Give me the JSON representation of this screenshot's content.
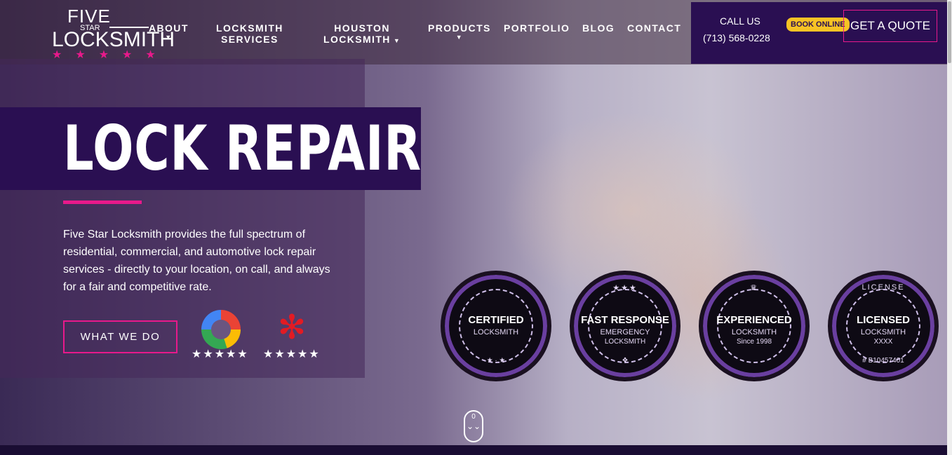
{
  "brand": {
    "logo_five": "FIVE",
    "logo_star": "STAR",
    "logo_locksmith": "LOCKSMITH",
    "logo_stars": "★★★★★",
    "accent_pink": "#e8198b",
    "accent_purple": "#2a0f52",
    "accent_yellow": "#f7c324"
  },
  "nav": {
    "about": "ABOUT",
    "locksmith_services_1": "LOCKSMITH",
    "locksmith_services_2": "SERVICES",
    "houston_locksmith_1": "HOUSTON",
    "houston_locksmith_2": "LOCKSMITH",
    "products": "PRODUCTS",
    "portfolio": "PORTFOLIO",
    "blog": "BLOG",
    "contact": "CONTACT",
    "caret": "▼"
  },
  "cta": {
    "call_label": "CALL US",
    "phone": "(713) 568-0228",
    "book_online": "BOOK ONLINE",
    "get_quote": "GET A QUOTE"
  },
  "hero": {
    "title": "LOCK REPAIR",
    "description": "Five Star Locksmith provides the full spectrum of residential, commercial, and automotive lock repair services - directly to your location, on call, and always for a fair and competitive rate.",
    "button": "WHAT WE DO",
    "google_stars": "★★★★★",
    "yelp_stars": "★★★★★",
    "yelp_glyph": "✻"
  },
  "badges": [
    {
      "top": "",
      "line1": "CERTIFIED",
      "line2": "LOCKSMITH",
      "line3": "",
      "bottom": "★ · ★"
    },
    {
      "top": "★★★",
      "line1": "FAST RESPONSE",
      "line2": "EMERGENCY",
      "line3": "LOCKSMITH",
      "bottom": "❖"
    },
    {
      "top": "♛",
      "line1": "EXPERIENCED",
      "line2": "LOCKSMITH",
      "line3": "Since 1998",
      "bottom": ""
    },
    {
      "top": "LICENSE",
      "line1": "LICENSED",
      "line2": "LOCKSMITH",
      "line3": "XXXX",
      "bottom": "# B10457401"
    }
  ],
  "scroll": {
    "glyph": "0",
    "down": "⌄⌄"
  }
}
